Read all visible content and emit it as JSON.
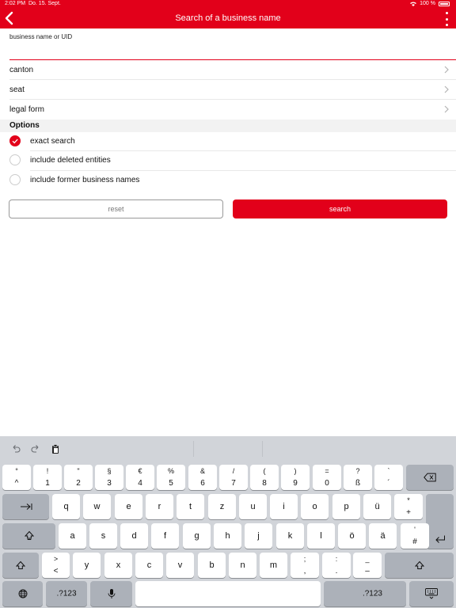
{
  "status": {
    "time": "2:02 PM",
    "date": "Do. 15. Sept.",
    "battery": "100 %"
  },
  "nav": {
    "title": "Search of a business name"
  },
  "form": {
    "field_label": "business name or UID",
    "field_value": "",
    "rows": [
      {
        "label": "canton"
      },
      {
        "label": "seat"
      },
      {
        "label": "legal form"
      }
    ]
  },
  "options": {
    "header": "Options",
    "items": [
      {
        "label": "exact search",
        "checked": true
      },
      {
        "label": "include deleted entities",
        "checked": false
      },
      {
        "label": "include former business names",
        "checked": false
      }
    ]
  },
  "buttons": {
    "reset": "reset",
    "search": "search"
  },
  "keyboard": {
    "row1": [
      {
        "t": "°",
        "b": "^"
      },
      {
        "t": "!",
        "b": "1"
      },
      {
        "t": "\"",
        "b": "2"
      },
      {
        "t": "§",
        "b": "3"
      },
      {
        "t": "€",
        "b": "4"
      },
      {
        "t": "%",
        "b": "5"
      },
      {
        "t": "&",
        "b": "6"
      },
      {
        "t": "/",
        "b": "7"
      },
      {
        "t": "(",
        "b": "8"
      },
      {
        "t": ")",
        "b": "9"
      },
      {
        "t": "=",
        "b": "0"
      },
      {
        "t": "?",
        "b": "ß"
      },
      {
        "t": "`",
        "b": "´"
      }
    ],
    "row2": [
      "q",
      "w",
      "e",
      "r",
      "t",
      "z",
      "u",
      "i",
      "o",
      "p",
      "ü"
    ],
    "row2_last": {
      "t": "*",
      "b": "+"
    },
    "row3": [
      "a",
      "s",
      "d",
      "f",
      "g",
      "h",
      "j",
      "k",
      "l",
      "ö",
      "ä"
    ],
    "row3_last": {
      "t": "'",
      "b": "#"
    },
    "row4_first": {
      "t": ">",
      "b": "<"
    },
    "row4": [
      "y",
      "x",
      "c",
      "v",
      "b",
      "n",
      "m"
    ],
    "row4_punct": [
      {
        "t": ";",
        "b": ","
      },
      {
        "t": ":",
        "b": "."
      },
      {
        "t": "_",
        "b": "–"
      }
    ],
    "numeric_label": ".?123"
  },
  "colors": {
    "accent": "#e2001a"
  }
}
